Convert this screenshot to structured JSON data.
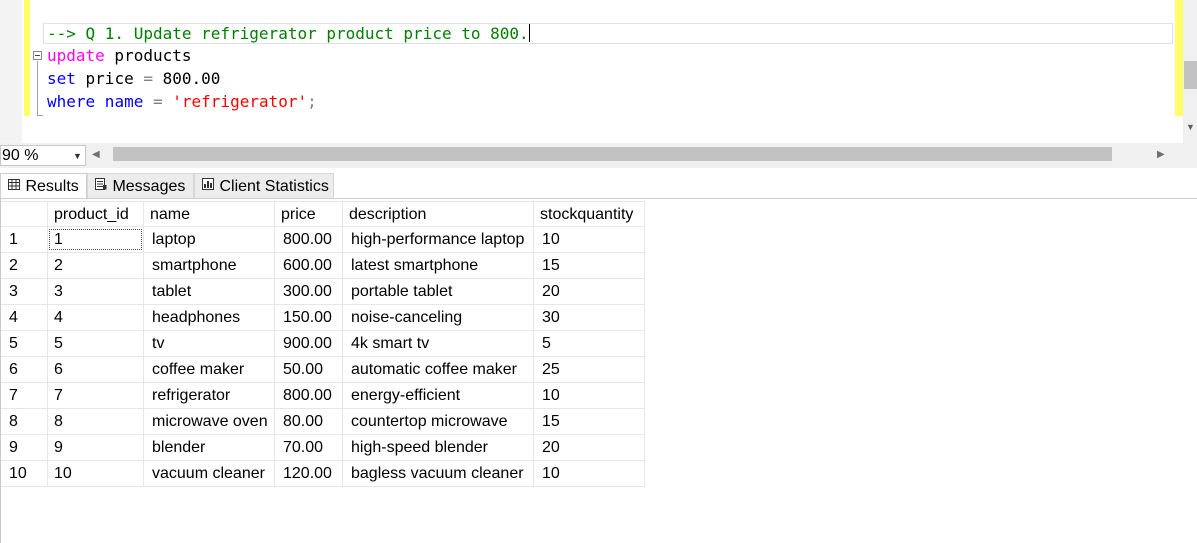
{
  "editor": {
    "lines": {
      "comment": "--> Q 1. Update refrigerator product price to 800.",
      "l2_kw": "update",
      "l2_rest": " products",
      "l3_kw": "set",
      "l3_a": " price ",
      "l3_op": "=",
      "l3_b": " 800.00",
      "l4_kw1": "where",
      "l4_kw2": " name",
      "l4_sp": " ",
      "l4_op": "=",
      "l4_sp2": " ",
      "l4_str": "'refrigerator'",
      "l4_semi": ";"
    }
  },
  "zoom": {
    "value": "90 %"
  },
  "tabs": [
    {
      "label": "Results",
      "icon": "grid-icon"
    },
    {
      "label": "Messages",
      "icon": "messages-icon"
    },
    {
      "label": "Client Statistics",
      "icon": "statistics-icon"
    }
  ],
  "results": {
    "columns": [
      "product_id",
      "name",
      "price",
      "description",
      "stockquantity"
    ],
    "rows": [
      [
        "1",
        "1",
        "laptop",
        "800.00",
        "high-performance laptop",
        "10"
      ],
      [
        "2",
        "2",
        "smartphone",
        "600.00",
        "latest smartphone",
        "15"
      ],
      [
        "3",
        "3",
        "tablet",
        "300.00",
        "portable tablet",
        "20"
      ],
      [
        "4",
        "4",
        "headphones",
        "150.00",
        "noise-canceling",
        "30"
      ],
      [
        "5",
        "5",
        "tv",
        "900.00",
        "4k smart tv",
        "5"
      ],
      [
        "6",
        "6",
        "coffee maker",
        "50.00",
        "automatic coffee maker",
        "25"
      ],
      [
        "7",
        "7",
        "refrigerator",
        "800.00",
        "energy-efficient",
        "10"
      ],
      [
        "8",
        "8",
        "microwave oven",
        "80.00",
        "countertop microwave",
        "15"
      ],
      [
        "9",
        "9",
        "blender",
        "70.00",
        "high-speed blender",
        "20"
      ],
      [
        "10",
        "10",
        "vacuum cleaner",
        "120.00",
        "bagless vacuum cleaner",
        "10"
      ]
    ]
  },
  "colors": {
    "change_bar": "#ffff66",
    "keyword_magenta": "#ff00ff",
    "keyword_blue": "#0000ff",
    "comment": "#008000",
    "string": "#ff0000"
  }
}
